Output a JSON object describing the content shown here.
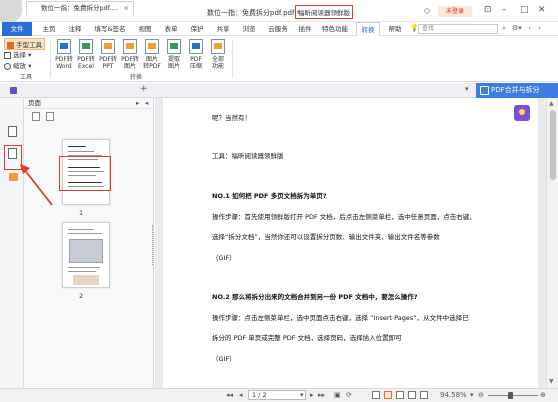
{
  "titlebar": {
    "title_text": "数位一指：免费拆分pdf.pdf *",
    "highlight_text": "福昕阅读器领鲜版",
    "login_label": "未登录",
    "quick_access": [
      "save-icon",
      "print-icon",
      "undo-icon",
      "redo-icon",
      "stamp-icon"
    ]
  },
  "menu": {
    "tabs": [
      {
        "label": "文件"
      },
      {
        "label": "主页"
      },
      {
        "label": "注释"
      },
      {
        "label": "填写&签名"
      },
      {
        "label": "视图"
      },
      {
        "label": "表单"
      },
      {
        "label": "保护"
      },
      {
        "label": "共享"
      },
      {
        "label": "浏览"
      },
      {
        "label": "云服务"
      },
      {
        "label": "特色功能"
      },
      {
        "label": "转换"
      },
      {
        "label": "帮助"
      }
    ],
    "search_placeholder": "查找"
  },
  "ribbon": {
    "tools": {
      "hand": "手型工具",
      "select": "选择",
      "zoom": "缩放",
      "group": "工具"
    },
    "convert_buttons": [
      {
        "label": "PDF转\nWord"
      },
      {
        "label": "PDF转\nExcel"
      },
      {
        "label": "PDF转\nPPT"
      },
      {
        "label": "PDF转\n图片"
      },
      {
        "label": "图片\n转PDF"
      },
      {
        "label": "提取\n图片"
      },
      {
        "label": "PDF\n压缩"
      },
      {
        "label": "全部\n功能"
      }
    ],
    "convert_group": "转换"
  },
  "doc_tab": {
    "label": "数位一指：免费拆分pdf....",
    "close": "×",
    "add": "+",
    "merge_label": "PDF合并与拆分"
  },
  "thumb_panel": {
    "title": "页面",
    "pages": [
      "1",
      "2"
    ]
  },
  "document": {
    "lines": [
      "呢？当然有！",
      "工具：福昕阅读器领鲜版",
      "NO.1 如何把 PDF 多页文档拆为单页?",
      "操作步骤：首先使用领鲜版打开 PDF 文档，后点击左侧菜单栏，选中任意页面，点击右键，",
      "选择“拆分文档”，当然你还可以设置拆分页数、输出文件夹、输出文件名等参数",
      "（GIF）",
      "NO.2 那么将拆分出来的文档合并到另一份 PDF 文档中，要怎么操作?",
      "操作步骤：点击左侧菜单栏，选中页面点击右键，选择 “Insert Pages”，从文件中选择已",
      "拆分的 PDF 单页或完整 PDF 文档，选择页码，选择插入位置即可",
      "（GIF）"
    ]
  },
  "statusbar": {
    "page_value": "1 / 2",
    "zoom": "94.58%"
  },
  "colors": {
    "accent": "#2b6fd6",
    "highlight": "#e23a2e",
    "merge": "#3d7de0"
  }
}
